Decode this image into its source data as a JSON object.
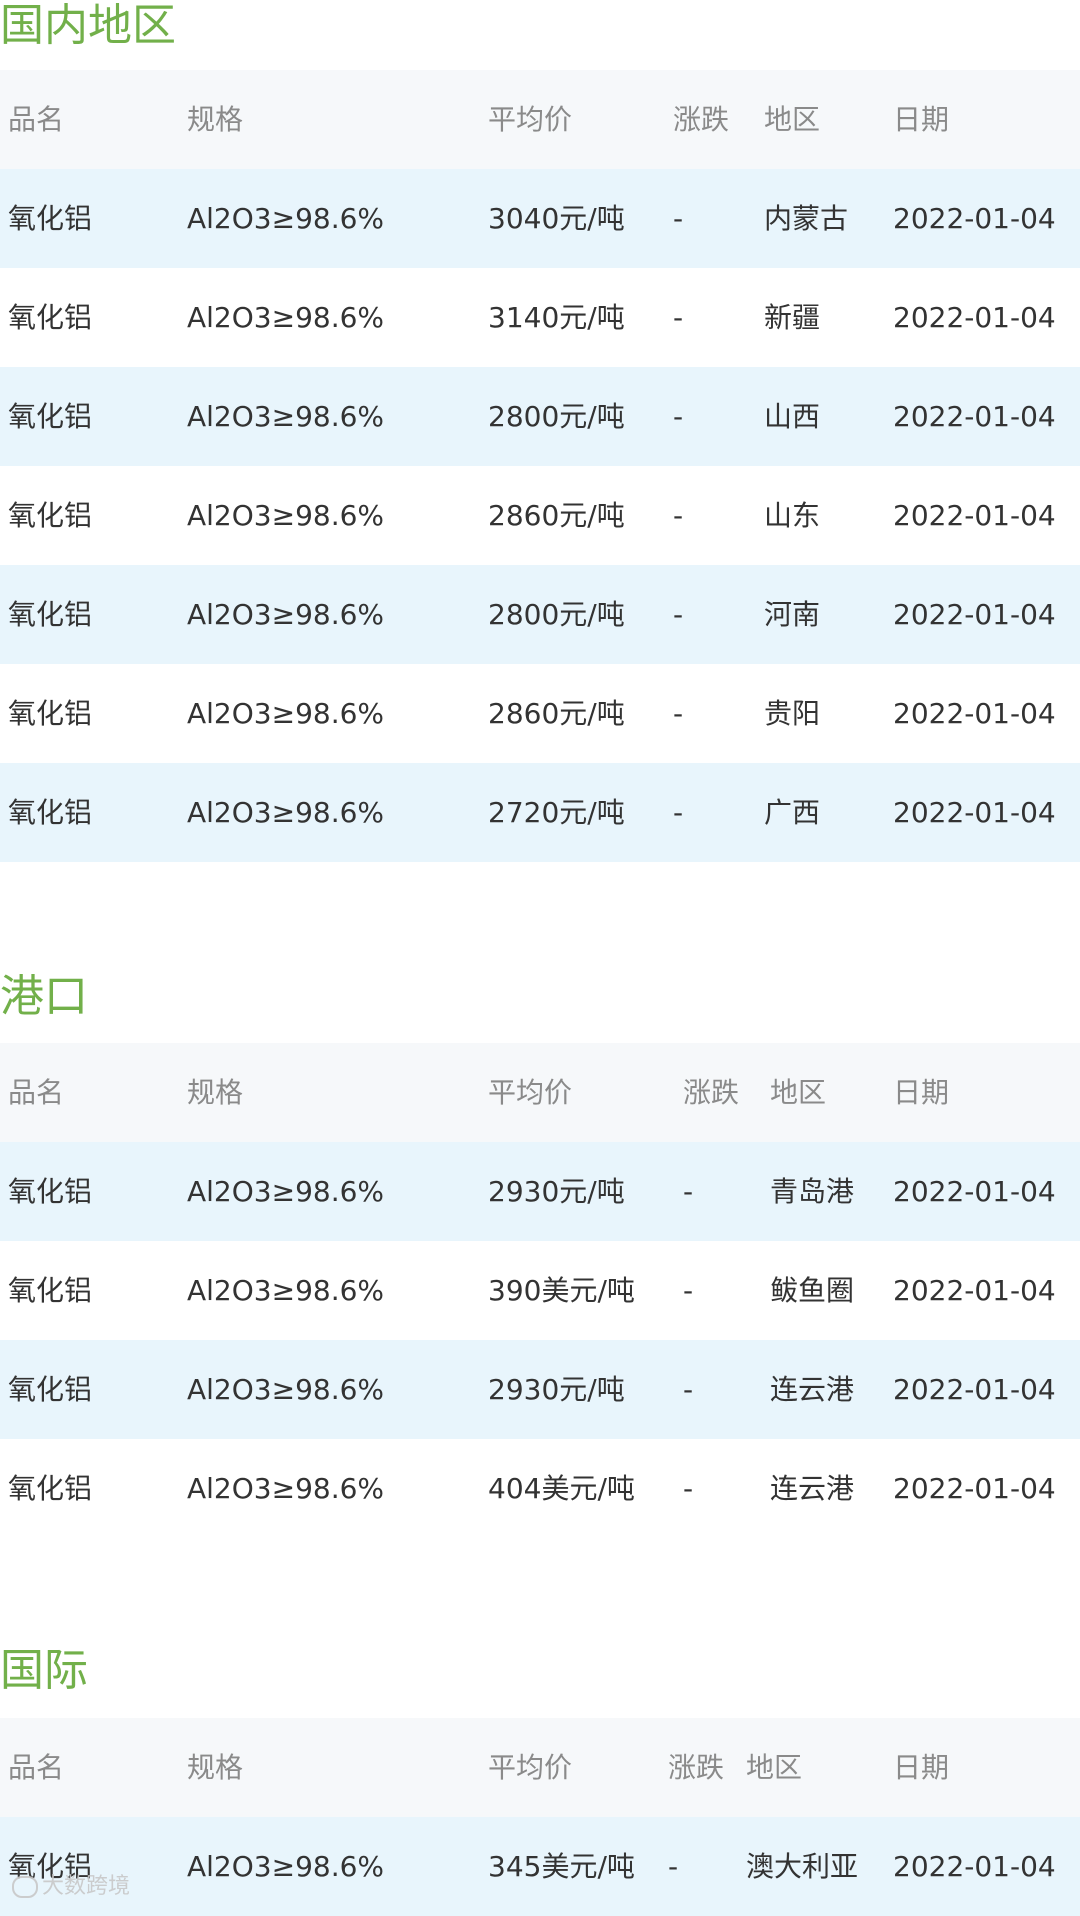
{
  "sections": [
    {
      "title": "国内地区",
      "headers": {
        "name": "品名",
        "spec": "规格",
        "price": "平均价",
        "change": "涨跌",
        "region": "地区",
        "date": "日期"
      },
      "rows": [
        {
          "name": "氧化铝",
          "spec": "Al2O3≥98.6%",
          "price": "3040元/吨",
          "change": "-",
          "region": "内蒙古",
          "date": "2022-01-04"
        },
        {
          "name": "氧化铝",
          "spec": "Al2O3≥98.6%",
          "price": "3140元/吨",
          "change": "-",
          "region": "新疆",
          "date": "2022-01-04"
        },
        {
          "name": "氧化铝",
          "spec": "Al2O3≥98.6%",
          "price": "2800元/吨",
          "change": "-",
          "region": "山西",
          "date": "2022-01-04"
        },
        {
          "name": "氧化铝",
          "spec": "Al2O3≥98.6%",
          "price": "2860元/吨",
          "change": "-",
          "region": "山东",
          "date": "2022-01-04"
        },
        {
          "name": "氧化铝",
          "spec": "Al2O3≥98.6%",
          "price": "2800元/吨",
          "change": "-",
          "region": "河南",
          "date": "2022-01-04"
        },
        {
          "name": "氧化铝",
          "spec": "Al2O3≥98.6%",
          "price": "2860元/吨",
          "change": "-",
          "region": "贵阳",
          "date": "2022-01-04"
        },
        {
          "name": "氧化铝",
          "spec": "Al2O3≥98.6%",
          "price": "2720元/吨",
          "change": "-",
          "region": "广西",
          "date": "2022-01-04"
        }
      ]
    },
    {
      "title": "港口",
      "headers": {
        "name": "品名",
        "spec": "规格",
        "price": "平均价",
        "change": "涨跌",
        "region": "地区",
        "date": "日期"
      },
      "rows": [
        {
          "name": "氧化铝",
          "spec": "Al2O3≥98.6%",
          "price": "2930元/吨",
          "change": "-",
          "region": "青岛港",
          "date": "2022-01-04"
        },
        {
          "name": "氧化铝",
          "spec": "Al2O3≥98.6%",
          "price": "390美元/吨",
          "change": "-",
          "region": "鲅鱼圈",
          "date": "2022-01-04"
        },
        {
          "name": "氧化铝",
          "spec": "Al2O3≥98.6%",
          "price": "2930元/吨",
          "change": "-",
          "region": "连云港",
          "date": "2022-01-04"
        },
        {
          "name": "氧化铝",
          "spec": "Al2O3≥98.6%",
          "price": "404美元/吨",
          "change": "-",
          "region": "连云港",
          "date": "2022-01-04"
        }
      ]
    },
    {
      "title": "国际",
      "headers": {
        "name": "品名",
        "spec": "规格",
        "price": "平均价",
        "change": "涨跌",
        "region": "地区",
        "date": "日期"
      },
      "rows": [
        {
          "name": "氧化铝",
          "spec": "Al2O3≥98.6%",
          "price": "345美元/吨",
          "change": "-",
          "region": "澳大利亚",
          "date": "2022-01-04"
        }
      ]
    }
  ],
  "watermark": "大数跨境"
}
